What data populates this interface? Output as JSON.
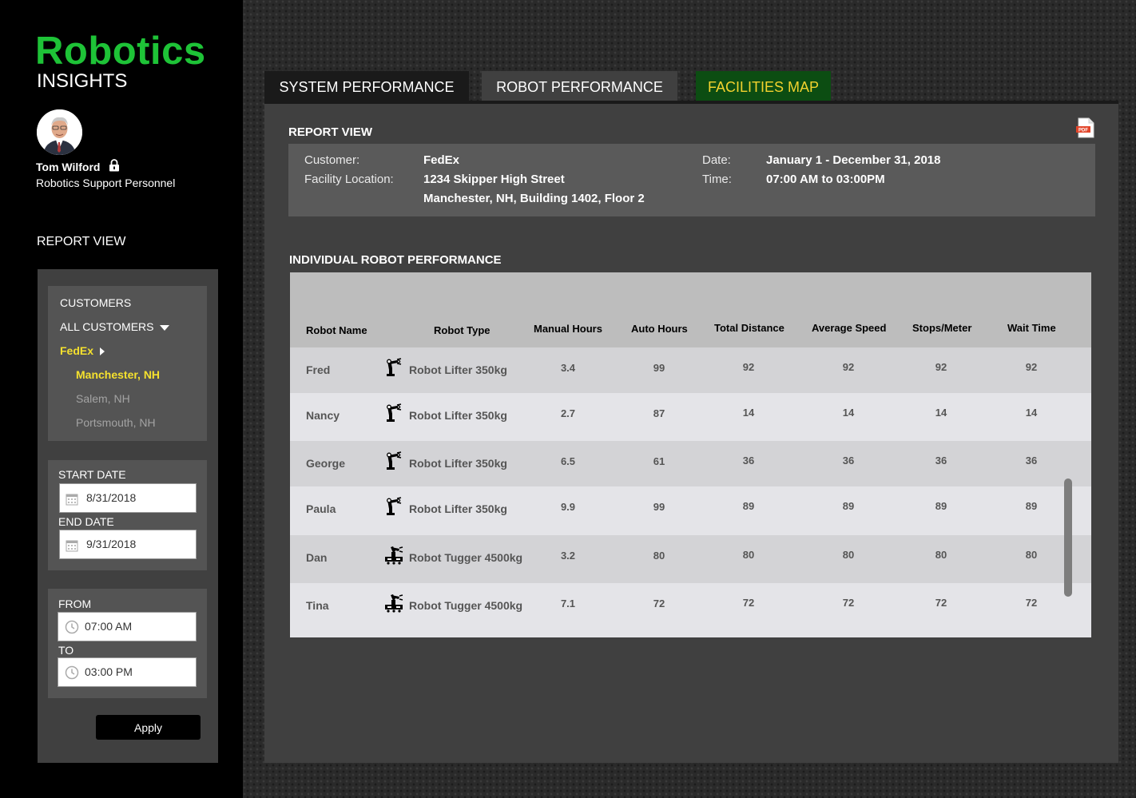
{
  "brand": {
    "title": "Robotics",
    "subtitle": "INSIGHTS"
  },
  "user": {
    "name": "Tom Wilford",
    "role": "Robotics Support Personnel"
  },
  "sidebar": {
    "report_view": "REPORT VIEW",
    "customers_label": "CUSTOMERS",
    "all_customers": "ALL CUSTOMERS",
    "customer": "FedEx",
    "locations": [
      "Manchester, NH",
      "Salem, NH",
      "Portsmouth, NH"
    ],
    "start_date_label": "START DATE",
    "start_date": "8/31/2018",
    "end_date_label": "END DATE",
    "end_date": "9/31/2018",
    "from_label": "FROM",
    "from_time": "07:00 AM",
    "to_label": "TO",
    "to_time": "03:00 PM",
    "apply": "Apply"
  },
  "tabs": [
    {
      "label": "SYSTEM PERFORMANCE"
    },
    {
      "label": "ROBOT PERFORMANCE"
    },
    {
      "label": "FACILITIES MAP"
    }
  ],
  "report": {
    "title": "REPORT VIEW",
    "pdf_icon_text": "PDF",
    "customer_label": "Customer:",
    "customer_value": "FedEx",
    "location_label": "Facility Location:",
    "location_line1": "1234 Skipper High Street",
    "location_line2": "Manchester, NH, Building 1402, Floor 2",
    "date_label": "Date:",
    "date_value": "January 1 - December 31, 2018",
    "time_label": "Time:",
    "time_value": "07:00 AM to 03:00PM"
  },
  "table": {
    "title": "INDIVIDUAL ROBOT PERFORMANCE",
    "headers": [
      "Robot Name",
      "Robot Type",
      "Manual Hours",
      "Auto Hours",
      "Total Distance",
      "Average Speed",
      "Stops/Meter",
      "Wait Time"
    ],
    "rows": [
      {
        "name": "Fred",
        "icon": "robot-arm-icon",
        "type": "Robot Lifter 350kg",
        "manual": "3.4",
        "auto": "99",
        "distance": "92",
        "speed": "92",
        "stops": "92",
        "wait": "92"
      },
      {
        "name": "Nancy",
        "icon": "robot-arm-icon",
        "type": "Robot Lifter 350kg",
        "manual": "2.7",
        "auto": "87",
        "distance": "14",
        "speed": "14",
        "stops": "14",
        "wait": "14"
      },
      {
        "name": "George",
        "icon": "robot-arm-icon",
        "type": "Robot Lifter 350kg",
        "manual": "6.5",
        "auto": "61",
        "distance": "36",
        "speed": "36",
        "stops": "36",
        "wait": "36"
      },
      {
        "name": "Paula",
        "icon": "robot-arm-icon",
        "type": "Robot Lifter 350kg",
        "manual": "9.9",
        "auto": "99",
        "distance": "89",
        "speed": "89",
        "stops": "89",
        "wait": "89"
      },
      {
        "name": "Dan",
        "icon": "tugger-robot-icon",
        "type": "Robot Tugger 4500kg",
        "manual": "3.2",
        "auto": "80",
        "distance": "80",
        "speed": "80",
        "stops": "80",
        "wait": "80"
      },
      {
        "name": "Tina",
        "icon": "tugger-robot-icon",
        "type": "Robot Tugger 4500kg",
        "manual": "7.1",
        "auto": "72",
        "distance": "72",
        "speed": "72",
        "stops": "72",
        "wait": "72"
      }
    ]
  },
  "colors": {
    "brand_green": "#1ec337",
    "highlight_yellow": "#f5e12e",
    "map_tab_bg": "#0c4d12",
    "pdf_red": "#e2452a"
  }
}
